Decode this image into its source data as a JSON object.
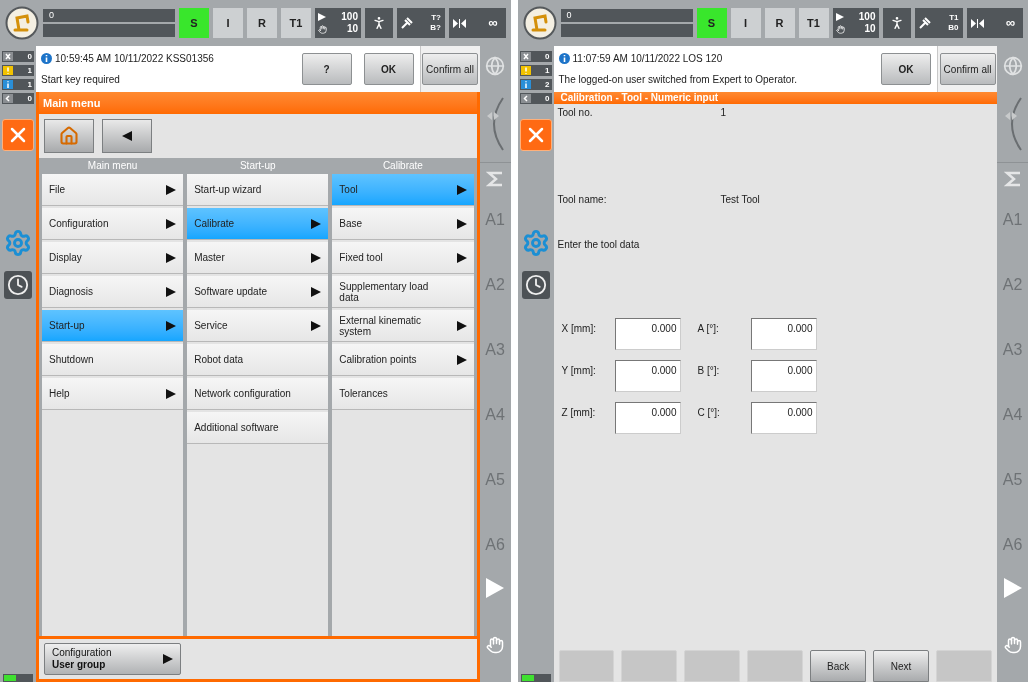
{
  "screens": [
    {
      "status_text": "0",
      "modes": [
        {
          "label": "S",
          "selected": true
        },
        {
          "label": "I",
          "selected": false
        },
        {
          "label": "R",
          "selected": false
        },
        {
          "label": "T1",
          "selected": false
        }
      ],
      "override": {
        "program": "100",
        "jog": "10"
      },
      "tool": "T?",
      "base": "B?",
      "run_mode": "∞",
      "counters": [
        {
          "kind": "error",
          "count": "0"
        },
        {
          "kind": "warning",
          "count": "1"
        },
        {
          "kind": "info",
          "count": "1"
        },
        {
          "kind": "wait",
          "count": "0"
        }
      ],
      "message": {
        "header": "10:59:45 AM 10/11/2022 KSS01356",
        "text": "Start key required",
        "buttons": [
          "?",
          "OK"
        ],
        "confirm_all": "Confirm all"
      },
      "jog_keys": [
        "A1",
        "A2",
        "A3",
        "A4",
        "A5",
        "A6"
      ],
      "content": {
        "kind": "main_menu",
        "title": "Main menu",
        "columns": [
          {
            "heading": "Main menu",
            "items": [
              {
                "label": "File",
                "submenu": true,
                "selected": false
              },
              {
                "label": "Configuration",
                "submenu": true,
                "selected": false
              },
              {
                "label": "Display",
                "submenu": true,
                "selected": false
              },
              {
                "label": "Diagnosis",
                "submenu": true,
                "selected": false
              },
              {
                "label": "Start-up",
                "submenu": true,
                "selected": true
              },
              {
                "label": "Shutdown",
                "submenu": false,
                "selected": false
              },
              {
                "label": "Help",
                "submenu": true,
                "selected": false
              }
            ]
          },
          {
            "heading": "Start-up",
            "items": [
              {
                "label": "Start-up wizard",
                "submenu": false,
                "selected": false
              },
              {
                "label": "Calibrate",
                "submenu": true,
                "selected": true
              },
              {
                "label": "Master",
                "submenu": true,
                "selected": false
              },
              {
                "label": "Software update",
                "submenu": true,
                "selected": false
              },
              {
                "label": "Service",
                "submenu": true,
                "selected": false
              },
              {
                "label": "Robot data",
                "submenu": false,
                "selected": false
              },
              {
                "label": "Network configuration",
                "submenu": false,
                "selected": false
              },
              {
                "label": "Additional software",
                "submenu": false,
                "selected": false
              }
            ]
          },
          {
            "heading": "Calibrate",
            "items": [
              {
                "label": "Tool",
                "submenu": true,
                "selected": true
              },
              {
                "label": "Base",
                "submenu": true,
                "selected": false
              },
              {
                "label": "Fixed tool",
                "submenu": true,
                "selected": false
              },
              {
                "label": "Supplementary load data",
                "submenu": false,
                "selected": false
              },
              {
                "label": "External kinematic system",
                "submenu": true,
                "selected": false
              },
              {
                "label": "Calibration points",
                "submenu": true,
                "selected": false
              },
              {
                "label": "Tolerances",
                "submenu": false,
                "selected": false
              }
            ]
          }
        ],
        "footer_button": {
          "top": "Configuration",
          "bottom": "User group"
        }
      }
    },
    {
      "status_text": "0",
      "modes": [
        {
          "label": "S",
          "selected": true
        },
        {
          "label": "I",
          "selected": false
        },
        {
          "label": "R",
          "selected": false
        },
        {
          "label": "T1",
          "selected": false
        }
      ],
      "override": {
        "program": "100",
        "jog": "10"
      },
      "tool": "T1",
      "base": "B0",
      "run_mode": "∞",
      "counters": [
        {
          "kind": "error",
          "count": "0"
        },
        {
          "kind": "warning",
          "count": "1"
        },
        {
          "kind": "info",
          "count": "2"
        },
        {
          "kind": "wait",
          "count": "0"
        }
      ],
      "message": {
        "header": "11:07:59 AM 10/11/2022 LOS 120",
        "text": "The logged-on user switched from Expert to Operator.",
        "buttons": [
          "OK"
        ],
        "confirm_all": "Confirm all"
      },
      "jog_keys": [
        "A1",
        "A2",
        "A3",
        "A4",
        "A5",
        "A6"
      ],
      "content": {
        "kind": "numeric_input",
        "title": "Calibration - Tool - Numeric input",
        "rows": [
          {
            "label": "Tool no.",
            "value": "1"
          },
          {
            "label": "Tool name:",
            "value": "Test Tool"
          }
        ],
        "prompt": "Enter the tool data",
        "fields": [
          {
            "label": "X [mm]:",
            "value": "0.000"
          },
          {
            "label": "A [°]:",
            "value": "0.000"
          },
          {
            "label": "Y [mm]:",
            "value": "0.000"
          },
          {
            "label": "B [°]:",
            "value": "0.000"
          },
          {
            "label": "Z [mm]:",
            "value": "0.000"
          },
          {
            "label": "C [°]:",
            "value": "0.000"
          }
        ],
        "softkeys": [
          {
            "kind": "blank"
          },
          {
            "kind": "blank"
          },
          {
            "kind": "blank"
          },
          {
            "kind": "blank"
          },
          {
            "kind": "button",
            "label": "Back"
          },
          {
            "kind": "button",
            "label": "Next"
          },
          {
            "kind": "blank"
          }
        ]
      }
    }
  ]
}
